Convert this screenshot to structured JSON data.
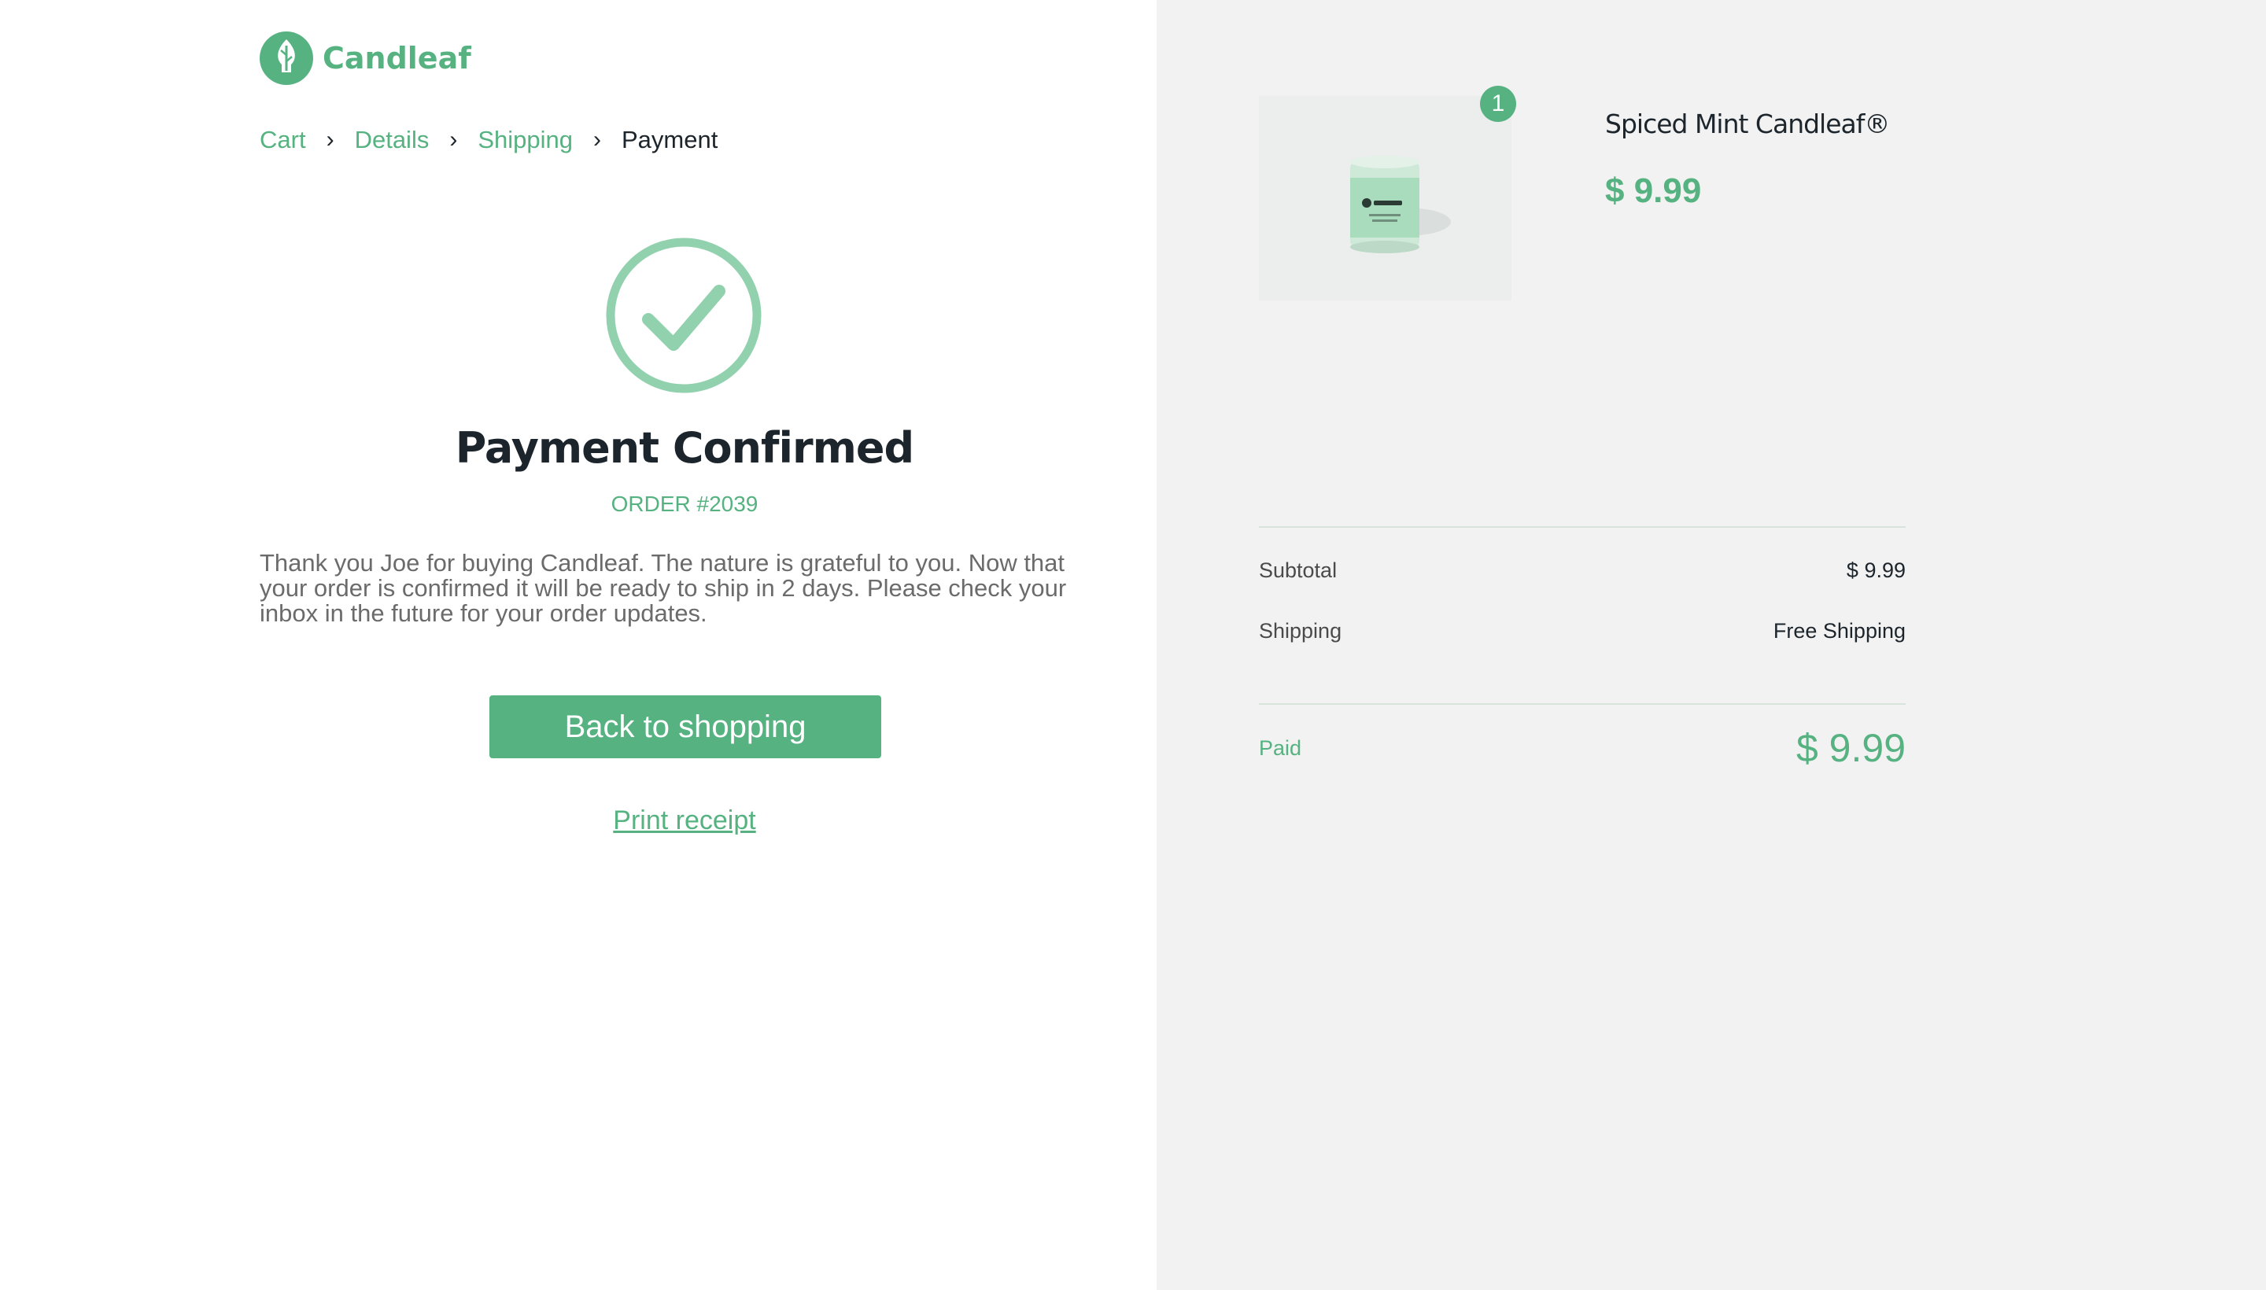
{
  "brand": {
    "name": "Candleaf",
    "accent": "#56b280",
    "logo_icon": "leaf-drop-icon"
  },
  "breadcrumb": {
    "items": [
      {
        "label": "Cart"
      },
      {
        "label": "Details"
      },
      {
        "label": "Shipping"
      },
      {
        "label": "Payment"
      }
    ],
    "separator_icon": "chevron-right-icon"
  },
  "confirmation": {
    "icon": "check-circle-icon",
    "title": "Payment Confirmed",
    "order_number": "ORDER #2039",
    "message": " Thank you Joe for buying Candleaf. The nature is grateful to you. Now that your order is confirmed it will be ready to ship in 2 days. Please check your inbox in the future for your order updates.",
    "back_button": "Back to shopping",
    "print_link": "Print receipt"
  },
  "order_summary": {
    "item": {
      "name": "Spiced Mint Candleaf®",
      "price": "$ 9.99",
      "quantity": "1"
    },
    "subtotal_label": "Subtotal",
    "subtotal_value": "$ 9.99",
    "shipping_label": "Shipping",
    "shipping_value": "Free Shipping",
    "paid_label": "Paid",
    "paid_value": "$ 9.99"
  }
}
